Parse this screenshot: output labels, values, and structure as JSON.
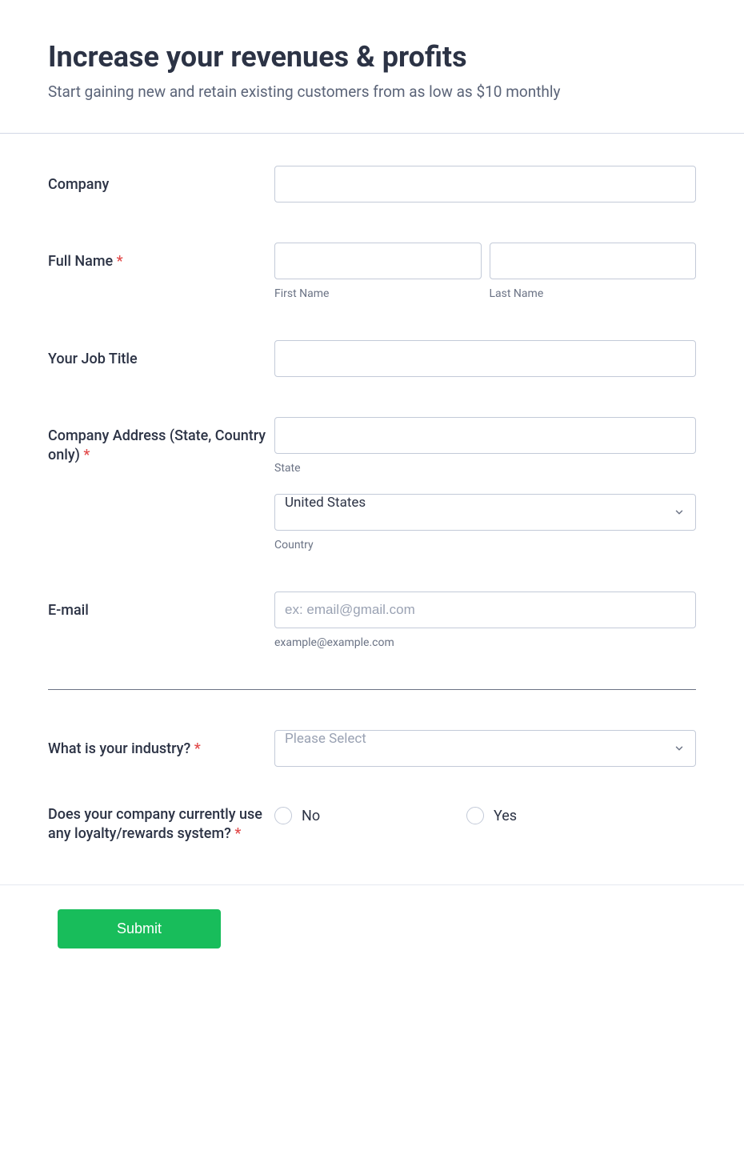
{
  "header": {
    "title": "Increase your revenues & profits",
    "subtitle": "Start gaining new and retain existing customers from as low as $10 monthly"
  },
  "form": {
    "company": {
      "label": "Company",
      "value": ""
    },
    "fullName": {
      "label": "Full Name",
      "required": "*",
      "firstName": {
        "value": "",
        "sublabel": "First Name"
      },
      "lastName": {
        "value": "",
        "sublabel": "Last Name"
      }
    },
    "jobTitle": {
      "label": "Your Job Title",
      "value": ""
    },
    "companyAddress": {
      "label": "Company Address (State, Country only)",
      "required": "*",
      "state": {
        "value": "",
        "sublabel": "State"
      },
      "country": {
        "value": "United States",
        "sublabel": "Country"
      }
    },
    "email": {
      "label": "E-mail",
      "value": "",
      "placeholder": "ex: email@gmail.com",
      "sublabel": "example@example.com"
    },
    "industry": {
      "label": "What is your industry?",
      "required": "*",
      "placeholder": "Please Select",
      "value": ""
    },
    "loyalty": {
      "label": "Does your company currently use any loyalty/rewards system?",
      "required": "*",
      "options": {
        "no": "No",
        "yes": "Yes"
      }
    }
  },
  "footer": {
    "submit": "Submit"
  }
}
